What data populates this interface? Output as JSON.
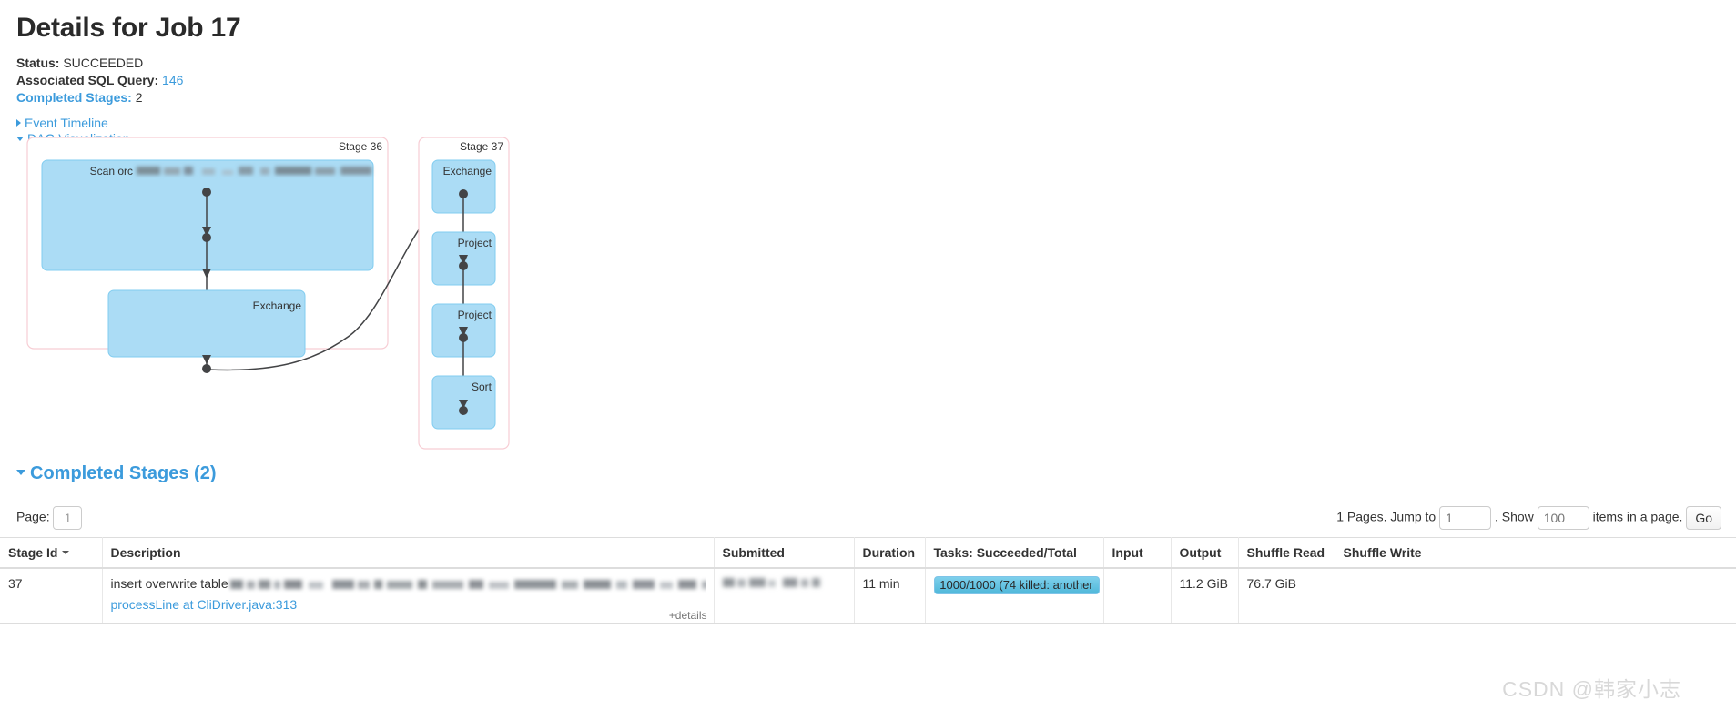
{
  "header": {
    "title": "Details for Job 17",
    "status_label": "Status:",
    "status_value": "SUCCEEDED",
    "sql_query_label": "Associated SQL Query:",
    "sql_query_value": "146",
    "completed_stages_label": "Completed Stages:",
    "completed_stages_value": "2"
  },
  "toggles": {
    "event_timeline": "Event Timeline",
    "dag_visualization": "DAG Visualization"
  },
  "dag": {
    "clusters": [
      {
        "id": "stage-36",
        "label": "Stage 36",
        "nodes": [
          {
            "label": "Scan orc",
            "blurred_suffix": true
          },
          {
            "label": "Exchange",
            "blurred_suffix": false
          }
        ]
      },
      {
        "id": "stage-37",
        "label": "Stage 37",
        "nodes": [
          {
            "label": "Exchange",
            "blurred_suffix": false
          },
          {
            "label": "Project",
            "blurred_suffix": false
          },
          {
            "label": "Project",
            "blurred_suffix": false
          },
          {
            "label": "Sort",
            "blurred_suffix": false
          }
        ]
      }
    ],
    "colors": {
      "node_fill": "#abdcf5",
      "node_stroke": "#82cdf0",
      "cluster_stroke": "#f7cdd4",
      "edge": "#434446"
    }
  },
  "stages_section": {
    "heading": "Completed Stages (2)",
    "page_label": "Page:",
    "page_value": "1",
    "pages_text": "1 Pages. Jump to",
    "jump_value": "1",
    "show_label": ". Show",
    "show_value": "100",
    "items_text": "items in a page.",
    "go_label": "Go",
    "columns": [
      "Stage Id",
      "Description",
      "Submitted",
      "Duration",
      "Tasks: Succeeded/Total",
      "Input",
      "Output",
      "Shuffle Read",
      "Shuffle Write"
    ],
    "rows": [
      {
        "stage_id": "37",
        "description_prefix": "insert overwrite table",
        "description_blurred": true,
        "description_link": "processLine at CliDriver.java:313",
        "details_toggle": "+details",
        "submitted_blurred": true,
        "duration": "11 min",
        "tasks_progress": "1000/1000 (74 killed: another",
        "tasks_percent": 100,
        "input": "",
        "output": "11.2 GiB",
        "shuffle_read": "76.7 GiB",
        "shuffle_write": ""
      }
    ]
  },
  "watermark": "CSDN @韩家小志"
}
